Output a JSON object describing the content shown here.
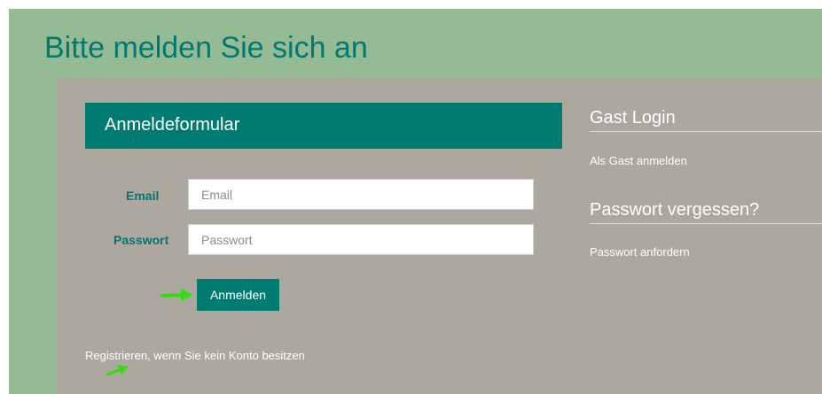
{
  "page": {
    "title": "Bitte melden Sie sich an"
  },
  "login_form": {
    "header": "Anmeldeformular",
    "email_label": "Email",
    "email_placeholder": "Email",
    "email_value": "",
    "password_label": "Passwort",
    "password_placeholder": "Passwort",
    "password_value": "",
    "submit_label": "Anmelden",
    "register_link": "Registrieren, wenn Sie kein Konto besitzen"
  },
  "guest_login": {
    "heading": "Gast Login",
    "link": "Als Gast anmelden"
  },
  "forgot_password": {
    "heading": "Passwort vergessen?",
    "link": "Passwort anfordern"
  },
  "icons": {
    "button_arrow": "green-arrow-icon",
    "register_arrow": "green-arrow-icon"
  },
  "colors": {
    "accent": "#007b72",
    "title": "#007a70",
    "header_band": "#95bb95",
    "panel": "#aca79f",
    "arrow": "#33dd11",
    "text_light": "#ffffff"
  }
}
